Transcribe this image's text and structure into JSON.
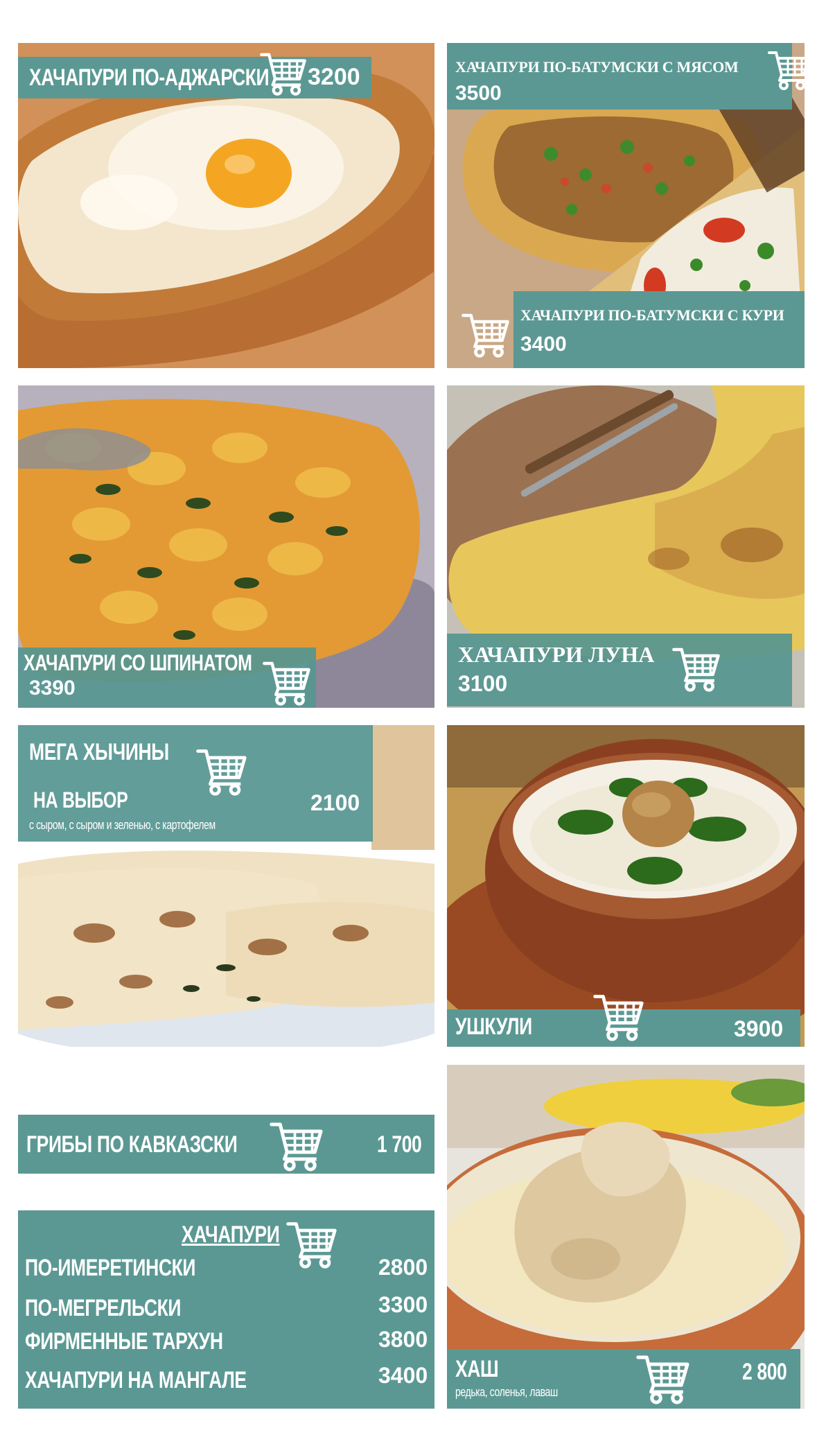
{
  "colors": {
    "band": "#5b9893",
    "text": "#ffffff",
    "background": "#ffffff"
  },
  "icons": {
    "cart": "shopping-cart-icon"
  },
  "cards": {
    "adjarian": {
      "name": "ХАЧАПУРИ ПО-АДЖАРСКИ",
      "price": "3200"
    },
    "batumi_meat": {
      "name": "ХАЧАПУРИ ПО-БАТУМСКИ С МЯСОМ",
      "price": "3500"
    },
    "batumi_chicken": {
      "name": "ХАЧАПУРИ ПО-БАТУМСКИ С КУРИ",
      "price": "3400"
    },
    "spinach": {
      "name": "ХАЧАПУРИ  СО ШПИНАТОМ",
      "price": "3390"
    },
    "luna": {
      "name": "ХАЧАПУРИ ЛУНА",
      "price": "3100"
    },
    "khychiny": {
      "name_line1": "МЕГА ХЫЧИНЫ",
      "name_line2": "НА ВЫБОР",
      "description": "с сыром, с сыром и  зеленью, с картофелем",
      "price": "2100"
    },
    "ushkuli": {
      "name": "УШКУЛИ",
      "price": "3900"
    },
    "mushrooms": {
      "name": "ГРИБЫ ПО КАВКАЗСКИ",
      "price": "1 700"
    },
    "khachapuri_list": {
      "header": "ХАЧАПУРИ",
      "items": [
        {
          "name": "ПО-ИМЕРЕТИНСКИ",
          "price": "2800"
        },
        {
          "name": "ПО-МЕГРЕЛЬСКИ",
          "price": "3300"
        },
        {
          "name": "ФИРМЕННЫЕ ТАРХУН",
          "price": "3800"
        },
        {
          "name": "ХАЧАПУРИ НА МАНГАЛЕ",
          "price": "3400"
        }
      ]
    },
    "khash": {
      "name": "ХАШ",
      "description": "редька, соленья, лаваш",
      "price": "2 800"
    }
  }
}
